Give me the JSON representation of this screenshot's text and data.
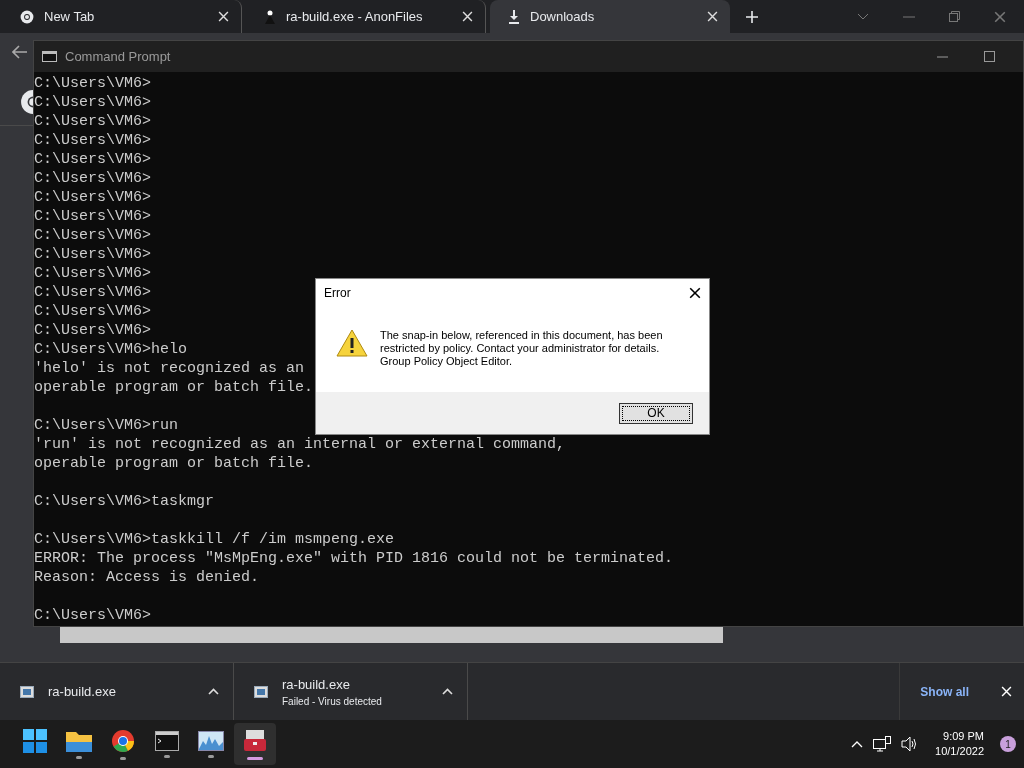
{
  "browser": {
    "tabs": [
      {
        "label": "New Tab",
        "kind": "chrome",
        "selected": false
      },
      {
        "label": "ra-build.exe - AnonFiles",
        "kind": "site",
        "selected": false
      },
      {
        "label": "Downloads",
        "kind": "download",
        "selected": true
      }
    ]
  },
  "console": {
    "title": "Command Prompt",
    "blocks": [
      [
        "C:\\Users\\VM6>",
        "C:\\Users\\VM6>",
        "C:\\Users\\VM6>",
        "C:\\Users\\VM6>",
        "C:\\Users\\VM6>",
        "C:\\Users\\VM6>",
        "C:\\Users\\VM6>",
        "C:\\Users\\VM6>",
        "C:\\Users\\VM6>",
        "C:\\Users\\VM6>",
        "C:\\Users\\VM6>",
        "C:\\Users\\VM6>",
        "C:\\Users\\VM6>",
        "C:\\Users\\VM6>",
        "C:\\Users\\VM6>helo",
        "'helo' is not recognized as an",
        "operable program or batch file."
      ],
      [
        "C:\\Users\\VM6>run",
        "'run' is not recognized as an internal or external command,",
        "operable program or batch file."
      ],
      [
        "C:\\Users\\VM6>taskmgr"
      ],
      [
        "C:\\Users\\VM6>taskkill /f /im msmpeng.exe",
        "ERROR: The process \"MsMpEng.exe\" with PID 1816 could not be terminated.",
        "Reason: Access is denied."
      ],
      [
        "C:\\Users\\VM6>"
      ]
    ]
  },
  "dialog": {
    "title": "Error",
    "message": [
      "The snap-in below, referenced in this document, has been",
      "restricted by policy. Contact your administrator for details.",
      "Group Policy Object Editor."
    ],
    "button": "OK"
  },
  "downloads": {
    "items": [
      {
        "name": "ra-build.exe"
      },
      {
        "name": "ra-build.exe",
        "status": "Failed - Virus detected"
      }
    ],
    "show_all": "Show all"
  },
  "taskbar": {
    "apps": [
      {
        "kind": "start",
        "running": false,
        "selected": false
      },
      {
        "kind": "folder",
        "running": true,
        "selected": false
      },
      {
        "kind": "chrome",
        "running": true,
        "selected": false
      },
      {
        "kind": "terminal",
        "running": true,
        "selected": false
      },
      {
        "kind": "monitor",
        "running": true,
        "selected": false
      },
      {
        "kind": "toolbox",
        "running": true,
        "selected": true
      }
    ],
    "time": "9:09 PM",
    "date": "10/1/2022",
    "notifications": "1"
  }
}
